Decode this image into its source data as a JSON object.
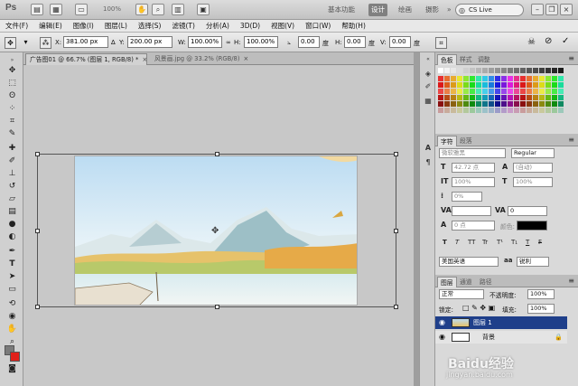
{
  "app": {
    "logo": "Ps",
    "zoom": "100%"
  },
  "workspaces": [
    "基本功能",
    "设计",
    "绘画",
    "摄影"
  ],
  "more_ws": "»",
  "search": {
    "label": "CS Live"
  },
  "menus": [
    "文件(F)",
    "编辑(E)",
    "图像(I)",
    "图层(L)",
    "选择(S)",
    "滤镜(T)",
    "分析(A)",
    "3D(D)",
    "视图(V)",
    "窗口(W)",
    "帮助(H)"
  ],
  "options": {
    "x_label": "X:",
    "x_value": "381.00 px",
    "y_label": "Y:",
    "y_value": "200.00 px",
    "w_label": "W:",
    "w_value": "100.00%",
    "h_label": "H:",
    "h_value": "100.00%",
    "rot_value": "0.00",
    "rot_unit": "度",
    "hs_label": "H:",
    "hs_value": "0.00",
    "hs_unit": "度",
    "vs_label": "V:",
    "vs_value": "0.00",
    "vs_unit": "度"
  },
  "doc_tabs": [
    {
      "label": "广告图01 @ 66.7% (图层 1, RGB/8) *",
      "close": "×"
    },
    {
      "label": "风景画.jpg @ 33.2% (RGB/8)",
      "close": "×"
    }
  ],
  "colors": {
    "foreground": "#7a7a7a",
    "background": "#e0201a",
    "accent": "#808080"
  },
  "swatch_panel": {
    "tabs": [
      "色板",
      "样式",
      "调整"
    ],
    "menu": "≡"
  },
  "char_panel": {
    "tabs": [
      "字符",
      "段落"
    ],
    "font_family": "微软雅黑",
    "font_style": "Regular",
    "font_size": "42.72 点",
    "leading": "(自动)",
    "vscale": "100%",
    "hscale": "100%",
    "baseline": "0%",
    "tracking": "0",
    "shift": "0 点",
    "color_label": "颜色:",
    "format_buttons": [
      "T",
      "T",
      "TT",
      "Tr",
      "T¹",
      "T₁",
      "T",
      "F"
    ],
    "language": "美国英语",
    "aa_icon": "aa",
    "aa": "锐利"
  },
  "layers_panel": {
    "tabs": [
      "图层",
      "通道",
      "路径"
    ],
    "blend": "正常",
    "opacity_label": "不透明度:",
    "opacity": "100%",
    "lock_label": "锁定:",
    "fill_label": "填充:",
    "fill": "100%",
    "layers": [
      {
        "name": "图层 1"
      },
      {
        "name": "背景"
      }
    ]
  },
  "watermark": {
    "brand": "Baidu经验",
    "url": "jingyan.baidu.com"
  }
}
